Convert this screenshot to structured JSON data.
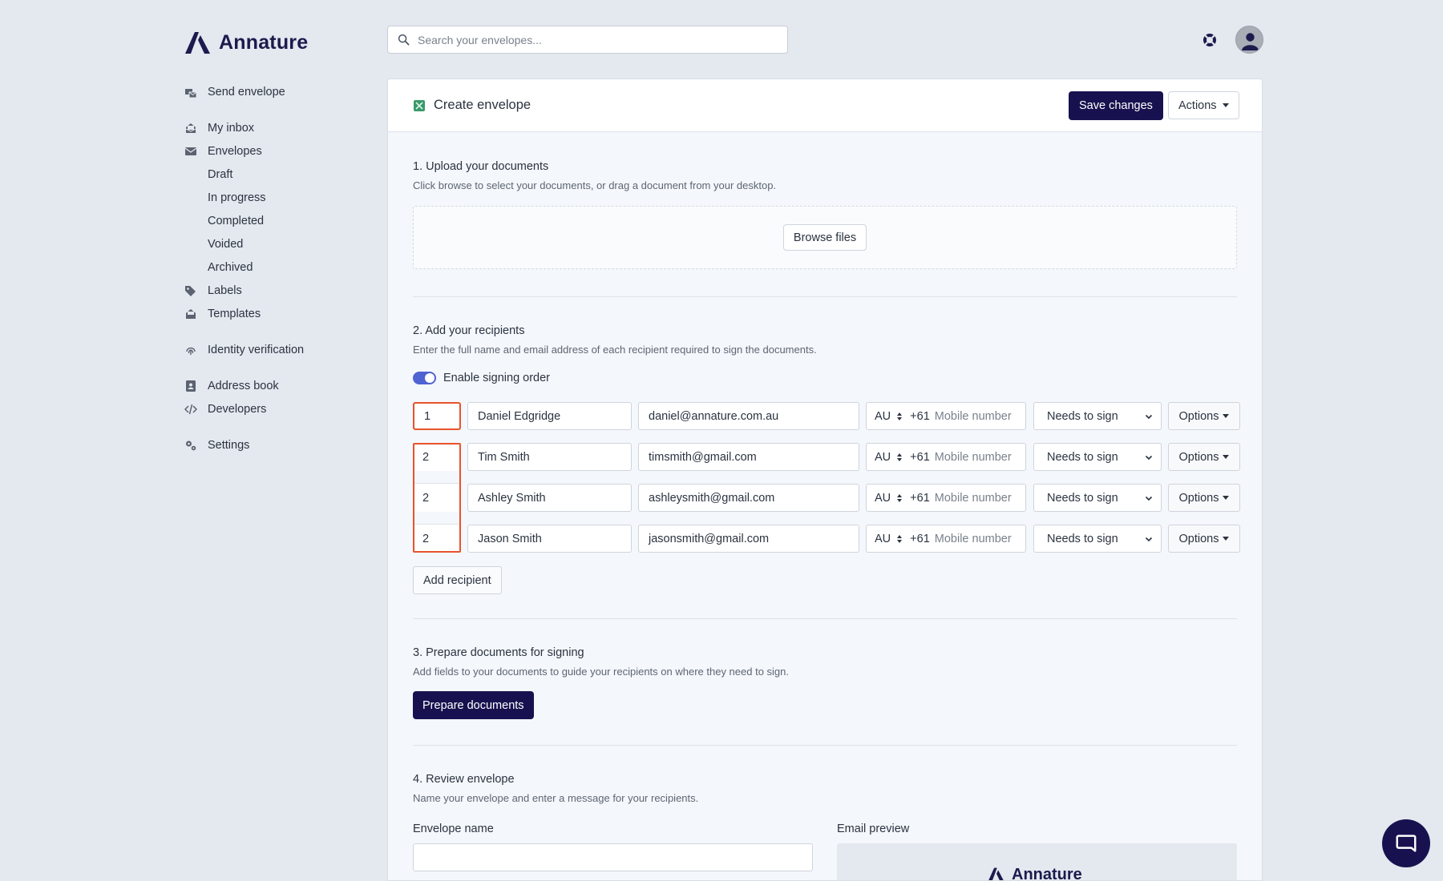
{
  "app": {
    "name": "Annature"
  },
  "search": {
    "placeholder": "Search your envelopes..."
  },
  "sidebar": {
    "items": [
      {
        "label": "Send envelope",
        "icon": "send-envelope-icon"
      },
      {
        "label": "My inbox",
        "icon": "inbox-icon"
      },
      {
        "label": "Envelopes",
        "icon": "envelope-icon"
      },
      {
        "label": "Draft"
      },
      {
        "label": "In progress"
      },
      {
        "label": "Completed"
      },
      {
        "label": "Voided"
      },
      {
        "label": "Archived"
      },
      {
        "label": "Labels",
        "icon": "tag-icon"
      },
      {
        "label": "Templates",
        "icon": "templates-icon"
      },
      {
        "label": "Identity verification",
        "icon": "fingerprint-icon"
      },
      {
        "label": "Address book",
        "icon": "address-book-icon"
      },
      {
        "label": "Developers",
        "icon": "code-icon"
      },
      {
        "label": "Settings",
        "icon": "gears-icon"
      }
    ]
  },
  "panel": {
    "title": "Create envelope",
    "save_label": "Save changes",
    "actions_label": "Actions"
  },
  "upload": {
    "title": "1. Upload your documents",
    "desc": "Click browse to select your documents, or drag a document from your desktop.",
    "browse_label": "Browse files"
  },
  "recipients": {
    "title": "2. Add your recipients",
    "desc": "Enter the full name and email address of each recipient required to sign the documents.",
    "signing_order_label": "Enable signing order",
    "signing_order_enabled": true,
    "rows": [
      {
        "order": "1",
        "name": "Daniel Edgridge",
        "email": "daniel@annature.com.au",
        "country": "AU",
        "dial": "+61",
        "phone_placeholder": "Mobile number",
        "role": "Needs to sign",
        "options": "Options"
      },
      {
        "order": "2",
        "name": "Tim Smith",
        "email": "timsmith@gmail.com",
        "country": "AU",
        "dial": "+61",
        "phone_placeholder": "Mobile number",
        "role": "Needs to sign",
        "options": "Options"
      },
      {
        "order": "2",
        "name": "Ashley Smith",
        "email": "ashleysmith@gmail.com",
        "country": "AU",
        "dial": "+61",
        "phone_placeholder": "Mobile number",
        "role": "Needs to sign",
        "options": "Options"
      },
      {
        "order": "2",
        "name": "Jason Smith",
        "email": "jasonsmith@gmail.com",
        "country": "AU",
        "dial": "+61",
        "phone_placeholder": "Mobile number",
        "role": "Needs to sign",
        "options": "Options"
      }
    ],
    "add_label": "Add recipient"
  },
  "prepare": {
    "title": "3. Prepare documents for signing",
    "desc": "Add fields to your documents to guide your recipients on where they need to sign.",
    "button_label": "Prepare documents"
  },
  "review": {
    "title": "4. Review envelope",
    "desc": "Name your envelope and enter a message for your recipients.",
    "envelope_name_label": "Envelope name",
    "envelope_name_value": "",
    "email_preview_label": "Email preview",
    "preview_logo_text": "Annature"
  },
  "colors": {
    "brand": "#17124f",
    "highlight": "#e8532c",
    "toggle": "#4f63d2",
    "background": "#e4e8ef"
  }
}
